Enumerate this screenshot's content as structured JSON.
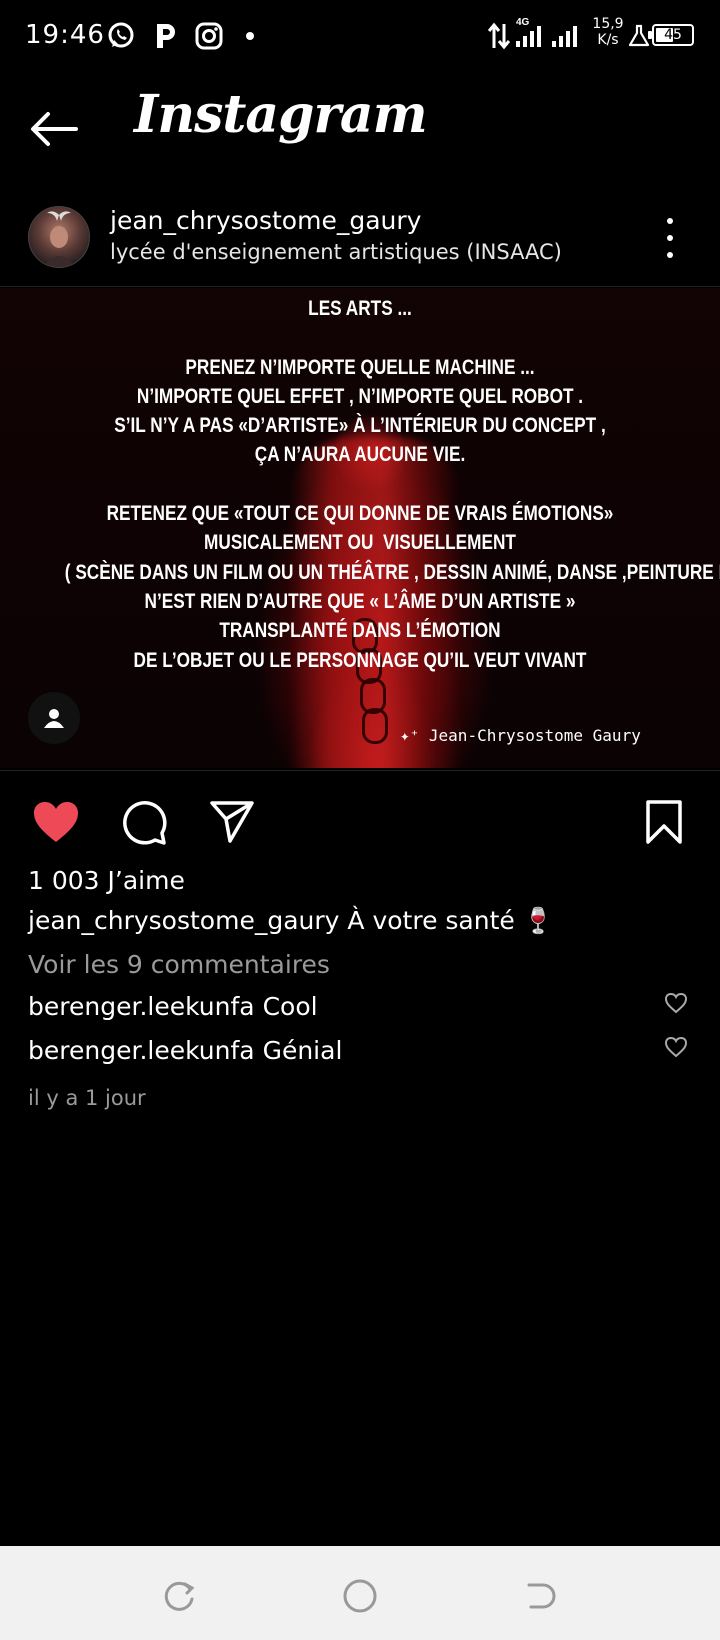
{
  "status_bar": {
    "time": "19:46",
    "network_type": "4G",
    "speed_value": "15,9",
    "speed_unit": "K/s",
    "battery": "45"
  },
  "header": {
    "title": "Instagram",
    "back_icon": "arrow-left-icon"
  },
  "post": {
    "username": "jean_chrysostome_gaury",
    "location": "lycée d'enseignement artistiques (INSAAC)",
    "image_text": "LES ARTS ...\n\nPRENEZ N’IMPORTE QUELLE MACHINE ...\nN’IMPORTE QUEL EFFET , N’IMPORTE QUEL ROBOT .\nS’IL N’Y A PAS «D’ARTISTE» À L’INTÉRIEUR DU CONCEPT ,\nÇA N’AURA AUCUNE VIE.\n\nRETENEZ QUE «TOUT CE QUI DONNE DE VRAIS ÉMOTIONS»\nMUSICALEMENT OU  VISUELLEMENT\n( SCÈNE DANS UN FILM OU UN THÉÂTRE , DESSIN ANIMÉ, DANSE ,PEINTURE ETC )\nN’EST RIEN D’AUTRE QUE « L’ÂME D’UN ARTISTE »\nTRANSPLANTÉ DANS L’ÉMOTION\nDE L’OBJET OU LE PERSONNAGE QU’IL VEUT VIVANT",
    "watermark": "Jean-Chrysostome Gaury",
    "likes": "1 003 J’aime",
    "liked": true,
    "caption_user": "jean_chrysostome_gaury",
    "caption_text": "À votre santé 🍷",
    "view_comments": "Voir les 9 commentaires",
    "comments": [
      {
        "user": "berenger.leekunfa",
        "text": "Cool"
      },
      {
        "user": "berenger.leekunfa",
        "text": "Génial"
      }
    ],
    "timestamp": "il y a 1 jour"
  },
  "colors": {
    "like_red": "#ed4956",
    "background": "#000000",
    "muted_text": "#9a9a9a",
    "nav_bar": "#f1f1f1"
  }
}
